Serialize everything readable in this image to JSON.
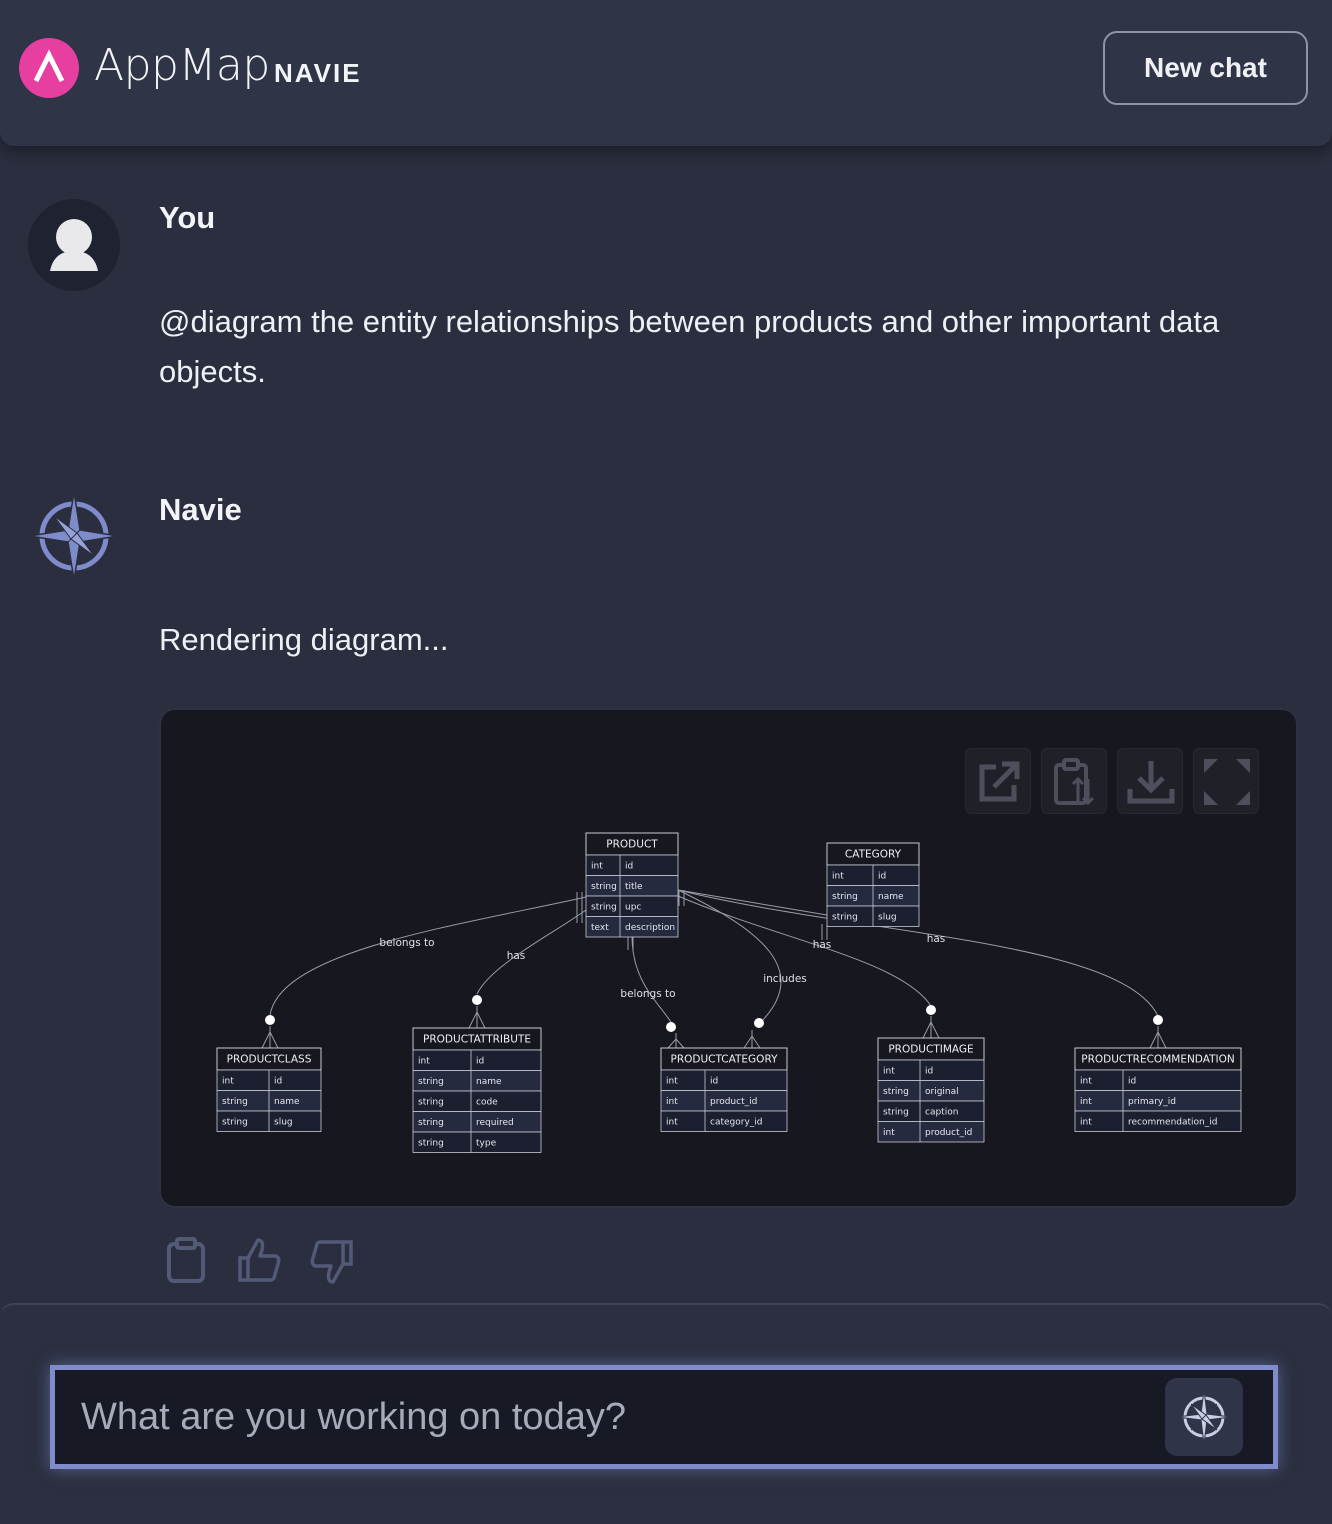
{
  "header": {
    "brand": "AppMap",
    "brand_sub": "NAVIE",
    "new_chat_label": "New chat"
  },
  "messages": [
    {
      "author": "You",
      "text": "@diagram the entity relationships between products and other important data objects."
    },
    {
      "author": "Navie",
      "text": "Rendering diagram..."
    }
  ],
  "diagram": {
    "toolbar": [
      "open-external-icon",
      "copy-icon",
      "download-icon",
      "fullscreen-icon"
    ],
    "entities": [
      {
        "name": "PRODUCT",
        "fields": [
          [
            "int",
            "id"
          ],
          [
            "string",
            "title"
          ],
          [
            "string",
            "upc"
          ],
          [
            "text",
            "description"
          ]
        ]
      },
      {
        "name": "CATEGORY",
        "fields": [
          [
            "int",
            "id"
          ],
          [
            "string",
            "name"
          ],
          [
            "string",
            "slug"
          ]
        ]
      },
      {
        "name": "PRODUCTCLASS",
        "fields": [
          [
            "int",
            "id"
          ],
          [
            "string",
            "name"
          ],
          [
            "string",
            "slug"
          ]
        ]
      },
      {
        "name": "PRODUCTATTRIBUTE",
        "fields": [
          [
            "int",
            "id"
          ],
          [
            "string",
            "name"
          ],
          [
            "string",
            "code"
          ],
          [
            "string",
            "required"
          ],
          [
            "string",
            "type"
          ]
        ]
      },
      {
        "name": "PRODUCTCATEGORY",
        "fields": [
          [
            "int",
            "id"
          ],
          [
            "int",
            "product_id"
          ],
          [
            "int",
            "category_id"
          ]
        ]
      },
      {
        "name": "PRODUCTIMAGE",
        "fields": [
          [
            "int",
            "id"
          ],
          [
            "string",
            "original"
          ],
          [
            "string",
            "caption"
          ],
          [
            "int",
            "product_id"
          ]
        ]
      },
      {
        "name": "PRODUCTRECOMMENDATION",
        "fields": [
          [
            "int",
            "id"
          ],
          [
            "int",
            "primary_id"
          ],
          [
            "int",
            "recommendation_id"
          ]
        ]
      }
    ],
    "relationship_labels": {
      "productclass": "belongs to",
      "productattribute": "has",
      "productcategory_product": "belongs to",
      "productcategory_category": "includes",
      "productimage": "has",
      "productrecommendation": "has"
    }
  },
  "feedback": [
    "clipboard-icon",
    "thumbs-up-icon",
    "thumbs-down-icon"
  ],
  "input": {
    "placeholder": "What are you working on today?"
  },
  "colors": {
    "accent": "#e63fa0",
    "input_border": "#7f8ccc",
    "compass": "#7f8ccc"
  }
}
